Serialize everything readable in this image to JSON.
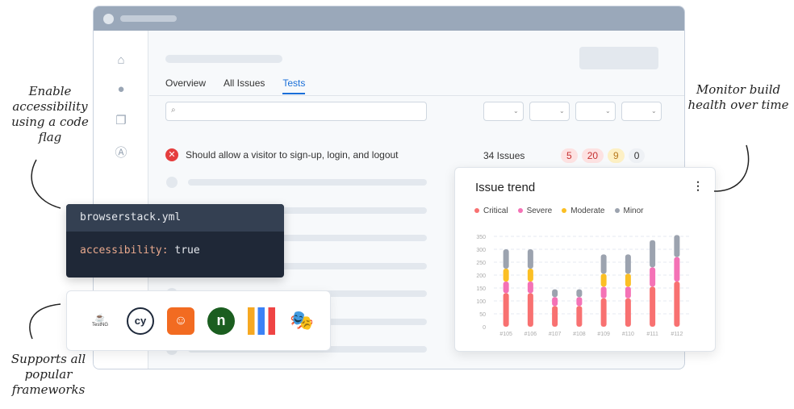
{
  "tabs": [
    "Overview",
    "All Issues",
    "Tests"
  ],
  "test_row": {
    "title": "Should allow a visitor to sign-up, login, and logout",
    "issues": "34 Issues",
    "badges": [
      {
        "value": "5",
        "bg": "#fde2e2",
        "fg": "#c53030"
      },
      {
        "value": "20",
        "bg": "#fde2e2",
        "fg": "#c53030"
      },
      {
        "value": "9",
        "bg": "#fdf0c4",
        "fg": "#b7791f"
      },
      {
        "value": "0",
        "bg": "#eef1f5",
        "fg": "#333"
      }
    ]
  },
  "code": {
    "filename": "browserstack.yml",
    "key": "accessibility:",
    "value": "true"
  },
  "frameworks": [
    "TestNG",
    "Cypress",
    "Robot Framework",
    "Nightwatch",
    "WebdriverIO",
    "Playwright"
  ],
  "notes": {
    "left_top": "Enable accessibility using a code flag",
    "left_bottom": "Supports all popular frameworks",
    "right": "Monitor build health over time"
  },
  "chart_data": {
    "type": "bar",
    "stacked": true,
    "title": "Issue trend",
    "categories": [
      "#105",
      "#106",
      "#107",
      "#108",
      "#109",
      "#110",
      "#111",
      "#112"
    ],
    "ylim": [
      0,
      350
    ],
    "yticks": [
      0,
      50,
      100,
      150,
      200,
      250,
      300,
      350
    ],
    "series": [
      {
        "name": "Critical",
        "color": "#f87171",
        "values": [
          130,
          130,
          80,
          80,
          110,
          110,
          155,
          175
        ]
      },
      {
        "name": "Severe",
        "color": "#f472b6",
        "values": [
          45,
          45,
          35,
          35,
          45,
          45,
          75,
          95
        ]
      },
      {
        "name": "Moderate",
        "color": "#fbbf24",
        "values": [
          50,
          50,
          0,
          0,
          50,
          50,
          0,
          0
        ]
      },
      {
        "name": "Minor",
        "color": "#9ca3af",
        "values": [
          75,
          75,
          30,
          30,
          75,
          75,
          105,
          85
        ]
      }
    ]
  }
}
